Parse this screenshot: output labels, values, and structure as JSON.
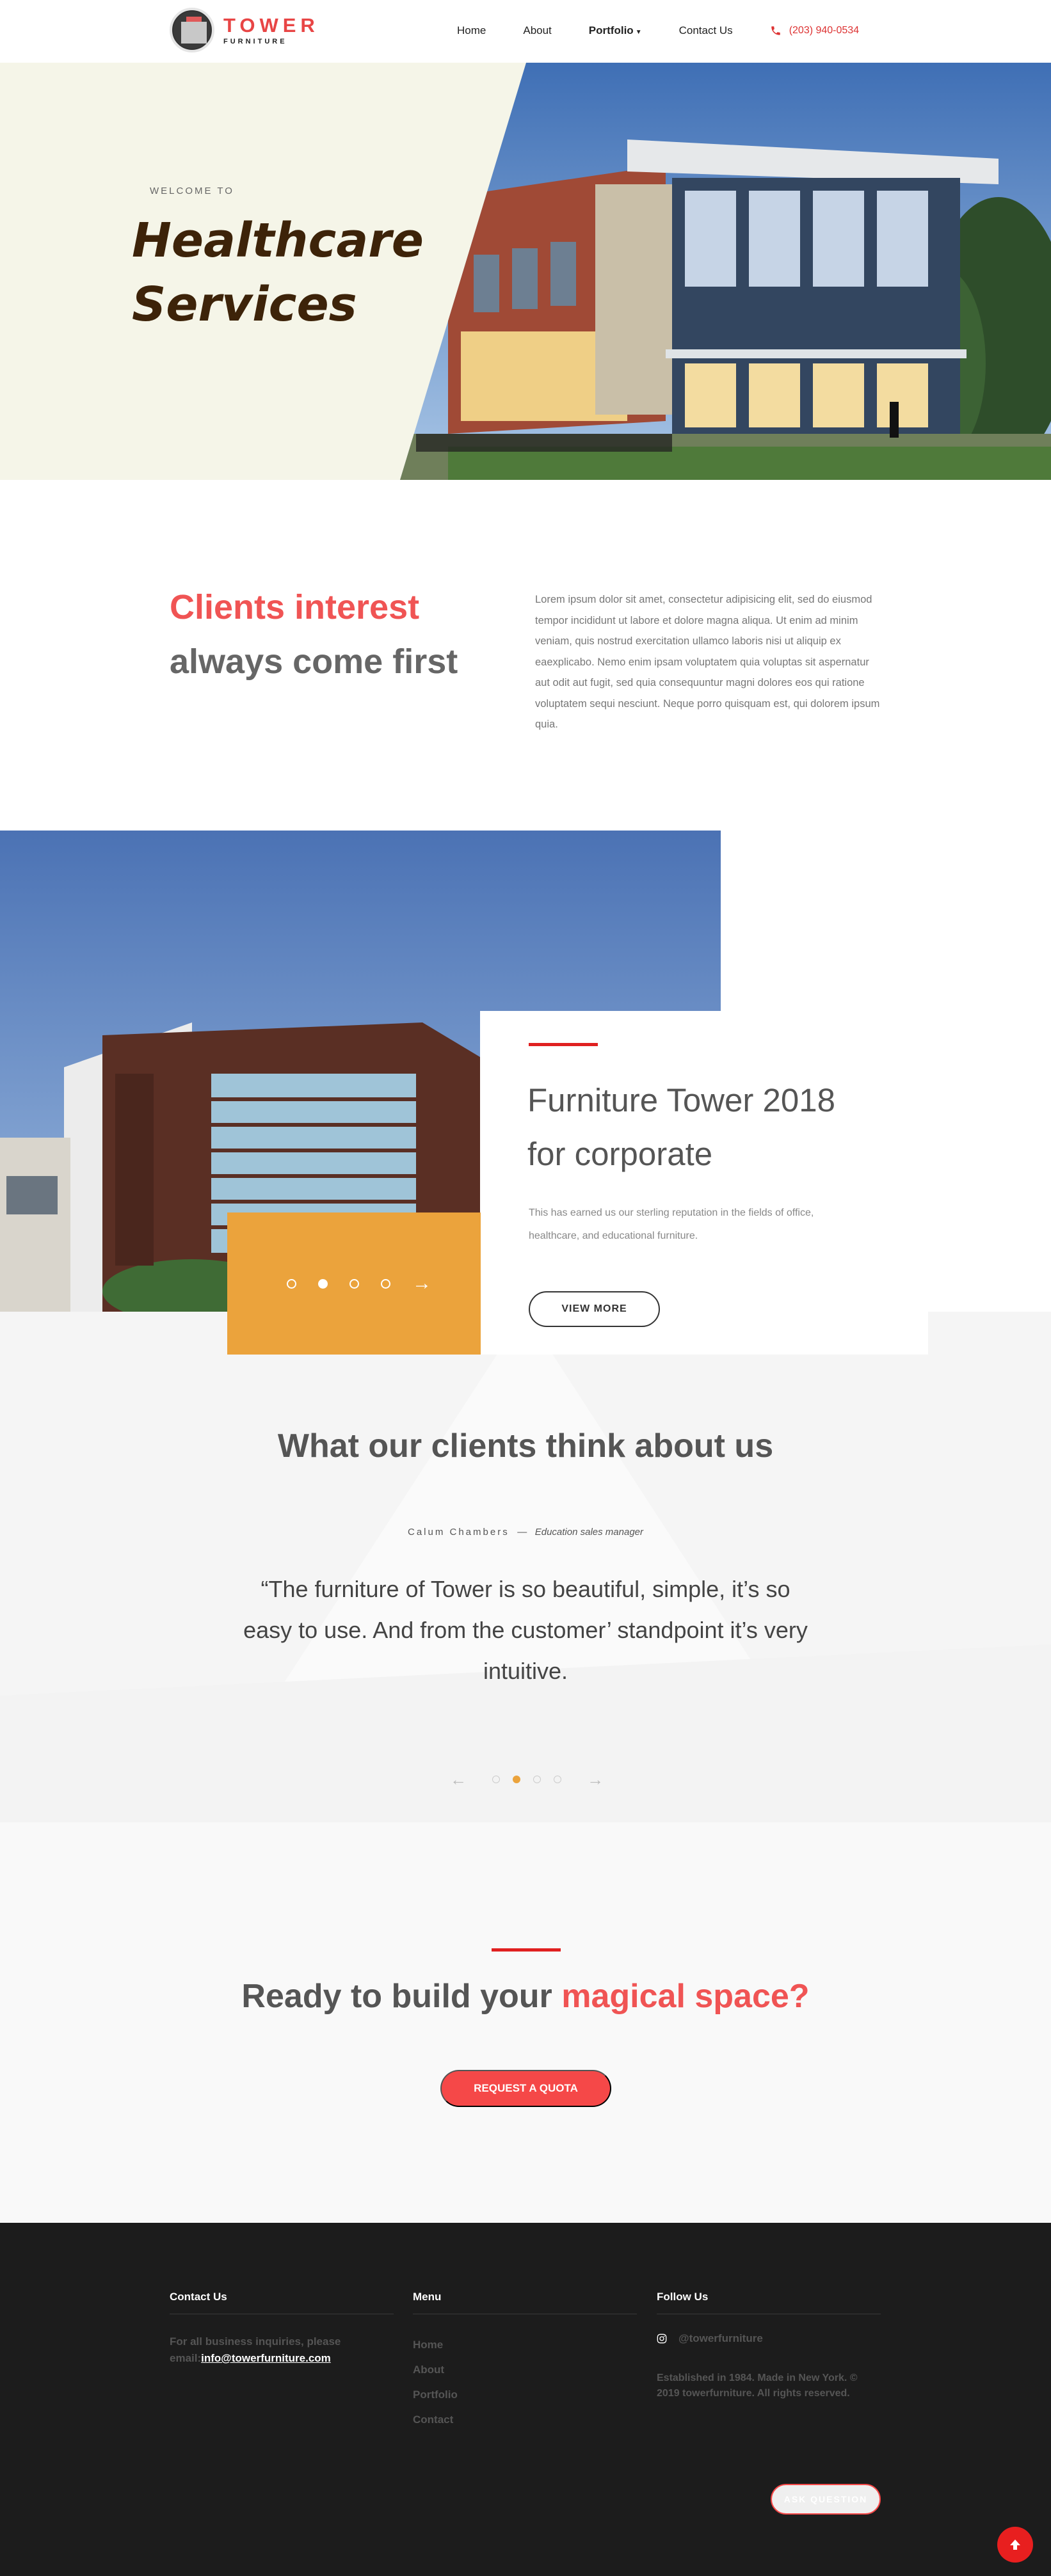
{
  "brand": {
    "name": "TOWER",
    "tagline": "FURNITURE"
  },
  "nav": {
    "items": [
      {
        "label": "Home"
      },
      {
        "label": "About"
      },
      {
        "label": "Portfolio"
      },
      {
        "label": "Contact Us"
      }
    ],
    "phone": "(203) 940-0534"
  },
  "hero": {
    "welcome": "WELCOME TO",
    "title_line1": "Healthcare",
    "title_line2": "Services"
  },
  "clients": {
    "heading_accent": "Clients interest",
    "heading_rest": "always come first",
    "paragraph": "Lorem ipsum dolor sit amet, consectetur adipisicing elit, sed do eiusmod tempor incididunt ut labore et dolore magna aliqua. Ut enim ad minim veniam, quis nostrud exercitation ullamco laboris nisi ut aliquip ex eaexplicabo. Nemo enim ipsam voluptatem quia voluptas sit aspernatur aut odit aut fugit, sed quia consequuntur magni dolores eos qui ratione voluptatem sequi nesciunt. Neque porro quisquam est, qui dolorem ipsum quia."
  },
  "feature": {
    "title_line1": "Furniture Tower 2018",
    "title_line2": "for corporate",
    "text_line1": "This has earned us our sterling reputation in the fields of office,",
    "text_line2": "healthcare, and educational furniture.",
    "button": "VIEW MORE",
    "slider": {
      "total": 4,
      "active": 2,
      "next_icon": "arrow-right-icon"
    }
  },
  "testimonial": {
    "title": "What our clients think about us",
    "author": "Calum Chambers",
    "separator": "—",
    "role": "Education sales manager",
    "quote": "“The furniture of Tower is so beautiful, simple, it’s so easy to use. And from the customer’ standpoint it’s very intuitive.",
    "slider": {
      "total": 4,
      "active": 2
    }
  },
  "cta": {
    "title_start": "Ready to build your",
    "title_highlight": "magical space?",
    "button": "REQUEST A QUOTA"
  },
  "footer": {
    "contact": {
      "heading": "Contact Us",
      "text": "For all business inquiries, please email:",
      "email": "info@towerfurniture.com"
    },
    "menu": {
      "heading": "Menu",
      "items": [
        {
          "label": "Home"
        },
        {
          "label": "About"
        },
        {
          "label": "Portfolio"
        },
        {
          "label": "Contact"
        }
      ]
    },
    "follow": {
      "heading": "Follow Us",
      "instagram": "@towerfurniture",
      "established": "Established in 1984. Made in New York. © 2019 towerfurniture. All rights reserved."
    },
    "ask_button": "ASK QUESTION"
  },
  "colors": {
    "accent_red": "#f05454",
    "orange": "#eba33c",
    "footer_bg": "#1c1c1c",
    "hero_bg": "#f5f5e8"
  }
}
